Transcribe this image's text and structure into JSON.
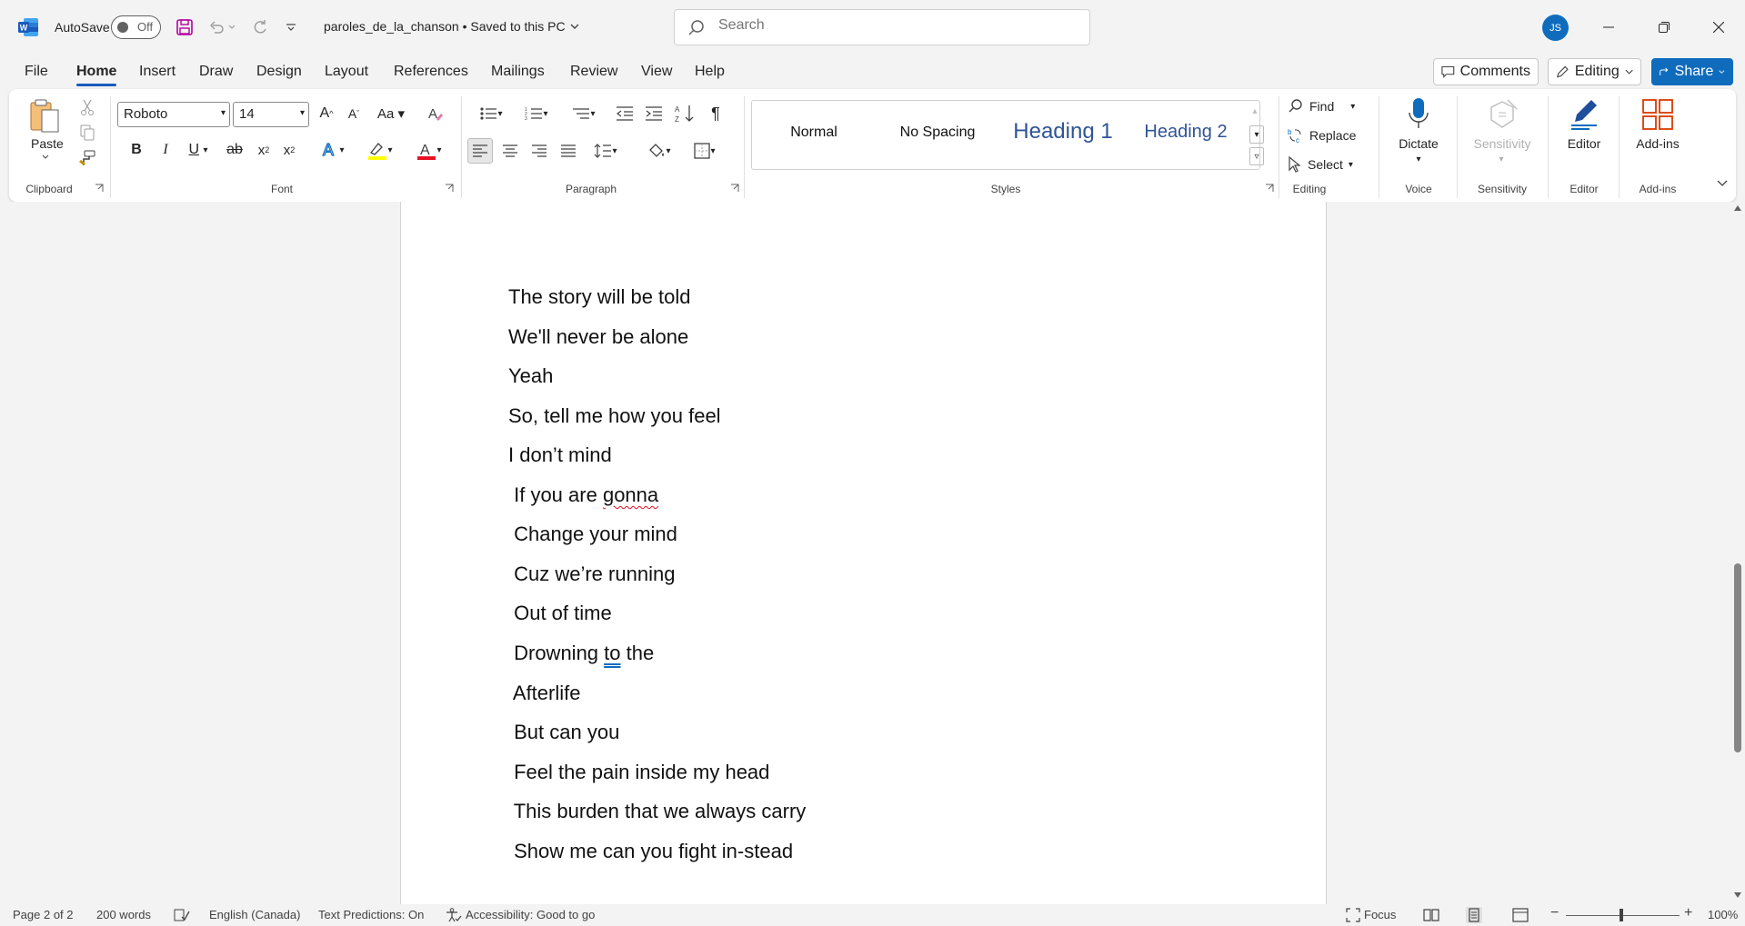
{
  "titlebar": {
    "autosave_label": "AutoSave",
    "autosave_state": "Off",
    "doc_title": "paroles_de_la_chanson • Saved to this PC",
    "search_placeholder": "Search",
    "user_initials": "JS"
  },
  "tabs": [
    "File",
    "Home",
    "Insert",
    "Draw",
    "Design",
    "Layout",
    "References",
    "Mailings",
    "Review",
    "View",
    "Help"
  ],
  "active_tab": "Home",
  "header_buttons": {
    "comments": "Comments",
    "editing": "Editing",
    "share": "Share"
  },
  "ribbon": {
    "clipboard": {
      "paste": "Paste",
      "label": "Clipboard"
    },
    "font": {
      "family": "Roboto",
      "size": "14",
      "label": "Font"
    },
    "paragraph": {
      "label": "Paragraph"
    },
    "styles": {
      "items": [
        "Normal",
        "No Spacing",
        "Heading 1",
        "Heading 2"
      ],
      "label": "Styles"
    },
    "editing": {
      "find": "Find",
      "replace": "Replace",
      "select": "Select",
      "label": "Editing"
    },
    "voice": {
      "dictate": "Dictate",
      "label": "Voice"
    },
    "sensitivity": {
      "button": "Sensitivity",
      "label": "Sensitivity"
    },
    "editor": {
      "button": "Editor",
      "label": "Editor"
    },
    "addins": {
      "button": "Add-ins",
      "label": "Add-ins"
    }
  },
  "document": {
    "lines": [
      "The story will be told",
      "We'll never be alone",
      "Yeah",
      "So, tell me how you feel",
      "I don’t mind",
      " If you are gonna",
      " Change your mind",
      " Cuz we’re running",
      " Out of time",
      " Drowning to the",
      " Afterlife",
      " But can you",
      " Feel the pain inside my head",
      " This burden that we always carry",
      " Show me can you fight in-stead"
    ]
  },
  "statusbar": {
    "page": "Page 2 of 2",
    "words": "200 words",
    "language": "English (Canada)",
    "predictions": "Text Predictions: On",
    "accessibility": "Accessibility: Good to go",
    "focus": "Focus",
    "zoom": "100%"
  }
}
